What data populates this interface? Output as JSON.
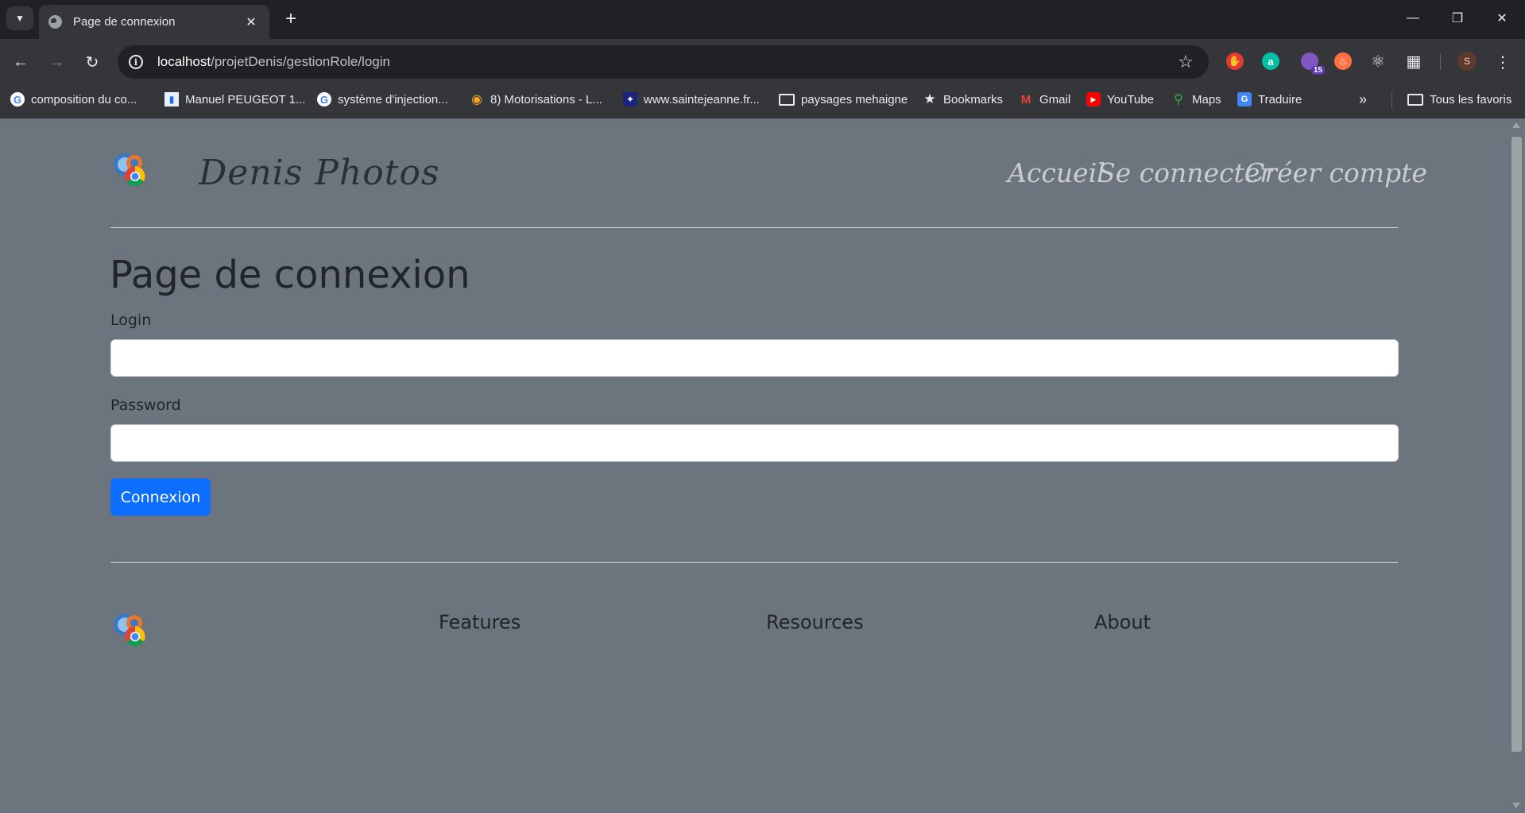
{
  "browser": {
    "tab_title": "Page de connexion",
    "url_host": "localhost",
    "url_path": "/projetDenis/gestionRole/login",
    "extension_badge": "15",
    "profile_initial": "S",
    "bookmarks": [
      {
        "label": "composition du co...",
        "icon": "google-icon"
      },
      {
        "label": "Manuel PEUGEOT 1...",
        "icon": "manual-icon"
      },
      {
        "label": "système d'injection...",
        "icon": "google-icon"
      },
      {
        "label": "8) Motorisations - L...",
        "icon": "site-icon"
      },
      {
        "label": "www.saintejeanne.fr...",
        "icon": "site-icon"
      },
      {
        "label": "paysages mehaigne",
        "icon": "folder-icon"
      },
      {
        "label": "Bookmarks",
        "icon": "star-icon"
      },
      {
        "label": "Gmail",
        "icon": "gmail-icon"
      },
      {
        "label": "YouTube",
        "icon": "youtube-icon"
      },
      {
        "label": "Maps",
        "icon": "maps-icon"
      },
      {
        "label": "Traduire",
        "icon": "translate-icon"
      }
    ],
    "all_bookmarks_label": "Tous les favoris"
  },
  "site": {
    "brand": "Denis Photos",
    "nav": [
      "Accueil",
      "Se connecter",
      "Créer compte"
    ]
  },
  "form": {
    "title": "Page de connexion",
    "login_label": "Login",
    "login_value": "",
    "password_label": "Password",
    "password_value": "",
    "submit_label": "Connexion"
  },
  "footer": {
    "columns": [
      "Features",
      "Resources",
      "About"
    ]
  },
  "colors": {
    "page_background": "#6c757d",
    "primary_button": "#0d6efd",
    "chrome_dark": "#202124",
    "chrome_toolbar": "#35363a"
  }
}
